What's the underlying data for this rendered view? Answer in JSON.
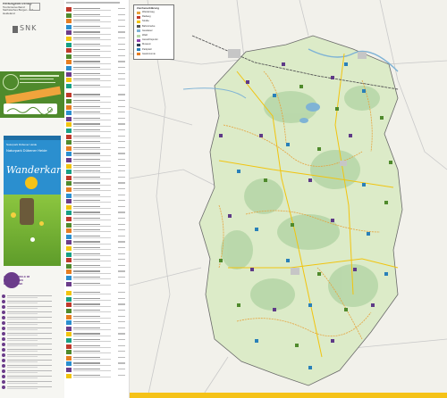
{
  "left_panel": {
    "publisher_lines": [
      "Herausgeber/Verlag:",
      "Tourismusverband",
      "Sächsisches Burgen- und",
      "Heideland",
      "www."
    ],
    "logo_text": "SNK",
    "promo_title": "Wanderkarte",
    "promo_subtitle": "Naturpark Dübener Heide",
    "promo_header": "Naturpark Dübener Heide",
    "bottom_header": "AUSFLUGSZIELE IM SÄCHSISCHEN BURGENLAND",
    "website": "www."
  },
  "list_panel": {
    "sections": [
      "Seite 1",
      "Seite 2",
      "LEGENDE"
    ]
  },
  "map": {
    "legend_title": "Zeichenerklärung",
    "legend_items": [
      {
        "label": "Wanderweg",
        "color": "#e6a23c"
      },
      {
        "label": "Radweg",
        "color": "#c0392b"
      },
      {
        "label": "Straße",
        "color": "#f1c40f"
      },
      {
        "label": "Bahnstrecke",
        "color": "#555555"
      },
      {
        "label": "Gewässer",
        "color": "#7fb3d5"
      },
      {
        "label": "Wald",
        "color": "#b7d7a8"
      },
      {
        "label": "Aussichtspunkt",
        "color": "#8e44ad"
      },
      {
        "label": "Museum",
        "color": "#2c3e50"
      },
      {
        "label": "Parkplatz",
        "color": "#2980b9"
      },
      {
        "label": "Gastronomie",
        "color": "#e67e22"
      }
    ],
    "region_color": "#dcebc8",
    "route_color": "#e6a23c",
    "poi_color": "#5e3a87",
    "water_color": "#7fb3d5"
  },
  "colors": {
    "brand_green": "#4f8a2c",
    "promo_blue": "#2b8fcf",
    "accent_purple": "#6b3c8a"
  }
}
